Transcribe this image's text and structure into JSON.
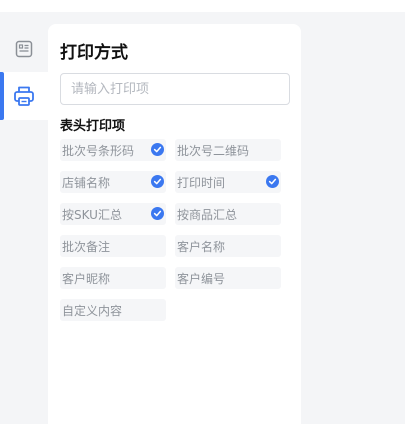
{
  "panel": {
    "title": "打印方式"
  },
  "search": {
    "placeholder": "请输入打印项",
    "value": ""
  },
  "section": {
    "title": "表头打印项"
  },
  "options": [
    {
      "label": "批次号条形码",
      "checked": true
    },
    {
      "label": "批次号二维码",
      "checked": false
    },
    {
      "label": "店铺名称",
      "checked": true
    },
    {
      "label": "打印时间",
      "checked": true
    },
    {
      "label": "按SKU汇总",
      "checked": true
    },
    {
      "label": "按商品汇总",
      "checked": false
    },
    {
      "label": "批次备注",
      "checked": false
    },
    {
      "label": "客户名称",
      "checked": false
    },
    {
      "label": "客户昵称",
      "checked": false
    },
    {
      "label": "客户编号",
      "checked": false
    },
    {
      "label": "自定义内容",
      "checked": false
    }
  ],
  "colors": {
    "accent": "#3b78f0",
    "rail_icon": "#8a8f96",
    "option_bg": "#f5f6f8",
    "option_text": "#8f949b"
  },
  "icons": {
    "rail_top": "layout-icon",
    "rail_active": "printer-icon",
    "option_checked": "checkmark-circle-icon"
  }
}
